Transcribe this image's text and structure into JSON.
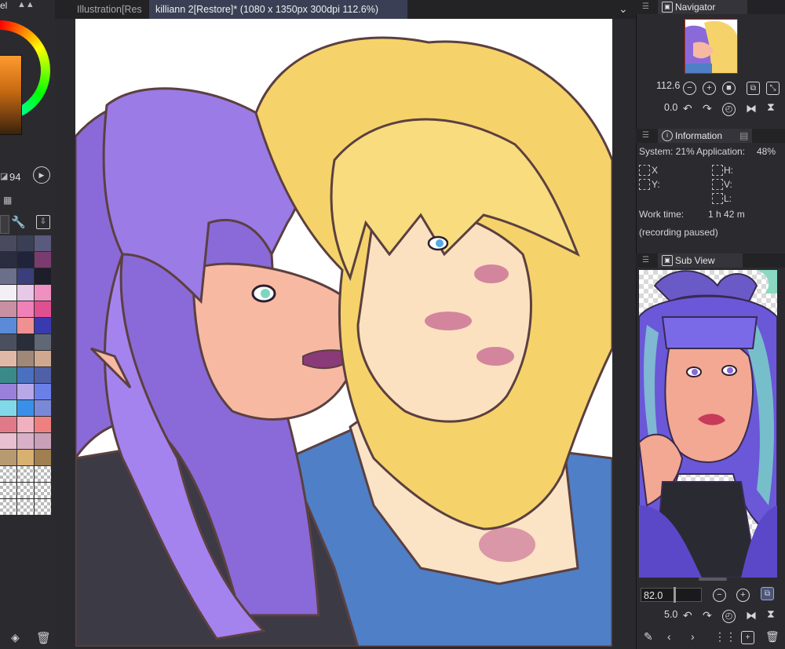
{
  "left_panel": {
    "header_label": "el",
    "opacity_value": "94",
    "swatches": [
      "#4a4a5e",
      "#3b3f55",
      "#5a5a7e",
      "#2a2d40",
      "#20243a",
      "#7a3c6e",
      "#6b6f8a",
      "#3a3e7a",
      "#1e1e2a",
      "#f2f0f5",
      "#e8c8e8",
      "#f090c0",
      "#c890a0",
      "#f080b8",
      "#e05090",
      "#5a8ad8",
      "#f09090",
      "#3a3ab0",
      "#4a5060",
      "#2a2e3a",
      "#606878",
      "#e0b8a8",
      "#a08878",
      "#d0a890",
      "#3a8a8a",
      "#4a70c0",
      "#5060a8",
      "#9a80d8",
      "#b8a8e8",
      "#6a80e8",
      "#80d8e8",
      "#3a90e8",
      "#7a88d8",
      "#e07a88",
      "#f0b0c0",
      "#f08080",
      "#e8c0d0",
      "#d8b0c8",
      "#c8a0b8",
      "#b89a70",
      "#d8b070",
      "#a08050"
    ]
  },
  "tabs": [
    {
      "label": "Illustration[Res"
    },
    {
      "label": "killiann 2[Restore]* (1080 x 1350px 300dpi 112.6%)"
    }
  ],
  "navigator": {
    "title": "Navigator",
    "zoom": "112.6",
    "rotation": "0.0"
  },
  "information": {
    "title": "Information",
    "system_label": "System: 21%",
    "application_label": "Application:",
    "application_value": "48%",
    "x_label": "X",
    "y_label": "Y:",
    "h_label": "H:",
    "v_label": "V:",
    "l_label": "L:",
    "work_time_label": "Work time:",
    "work_time_value": "1 h 42 m",
    "recording_status": "(recording paused)"
  },
  "subview": {
    "title": "Sub View",
    "zoom": "82.0",
    "rotation": "5.0"
  },
  "colors": {
    "accent_tab": "#3a3f55",
    "navigator_frame": "#c21f1f"
  }
}
